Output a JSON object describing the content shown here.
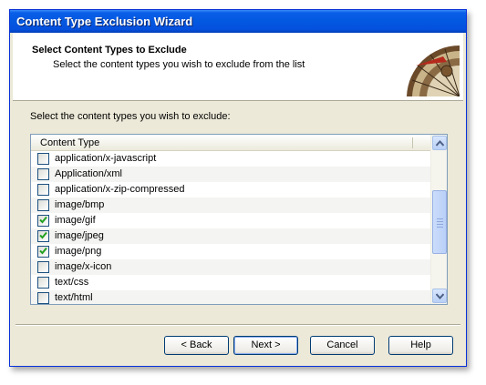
{
  "window": {
    "title": "Content Type Exclusion Wizard"
  },
  "header": {
    "title": "Select Content Types to Exclude",
    "subtitle": "Select the content types you wish to exclude from the list",
    "logo_icon": "compass-icon"
  },
  "body": {
    "prompt": "Select the content types you wish to exclude:",
    "list": {
      "column_header": "Content Type",
      "items": [
        {
          "label": "application/x-javascript",
          "checked": false
        },
        {
          "label": "Application/xml",
          "checked": false
        },
        {
          "label": "application/x-zip-compressed",
          "checked": false
        },
        {
          "label": "image/bmp",
          "checked": false
        },
        {
          "label": "image/gif",
          "checked": true
        },
        {
          "label": "image/jpeg",
          "checked": true
        },
        {
          "label": "image/png",
          "checked": true
        },
        {
          "label": "image/x-icon",
          "checked": false
        },
        {
          "label": "text/css",
          "checked": false
        },
        {
          "label": "text/html",
          "checked": false
        }
      ]
    }
  },
  "buttons": {
    "back": "< Back",
    "next": "Next >",
    "cancel": "Cancel",
    "help": "Help"
  },
  "colors": {
    "title_bar": "#0358e0",
    "check": "#21a121"
  }
}
